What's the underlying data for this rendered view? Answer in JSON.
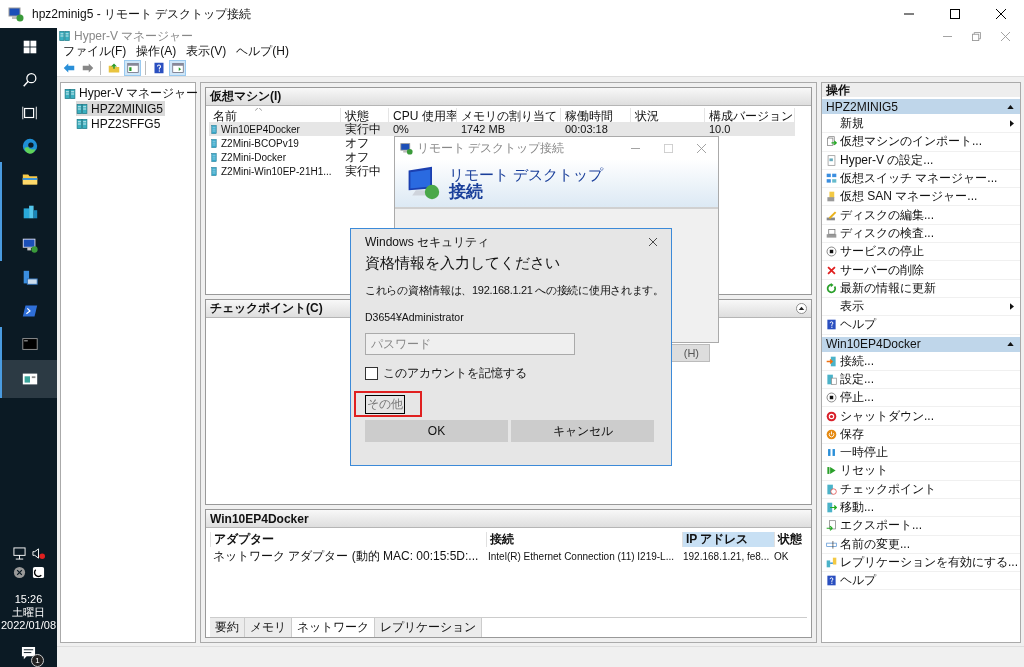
{
  "window": {
    "title": "hpz2minig5 - リモート デスクトップ接続"
  },
  "taskbar": {
    "apps": [
      {
        "running": false,
        "selected": false
      },
      {
        "running": false,
        "selected": false
      },
      {
        "running": false,
        "selected": false
      },
      {
        "running": false,
        "selected": false
      },
      {
        "running": true,
        "selected": false
      },
      {
        "running": true,
        "selected": false
      },
      {
        "running": true,
        "selected": false
      },
      {
        "running": false,
        "selected": false
      },
      {
        "running": false,
        "selected": false
      },
      {
        "running": true,
        "selected": false
      },
      {
        "running": true,
        "selected": true
      }
    ],
    "tray": {
      "time": "15:26",
      "day": "土曜日",
      "date": "2022/01/08",
      "notification_count": "1"
    }
  },
  "hyperv": {
    "title": "Hyper-V マネージャー",
    "menu": [
      "ファイル(F)",
      "操作(A)",
      "表示(V)",
      "ヘルプ(H)"
    ],
    "toolbar": [
      {
        "pressed": false
      },
      {
        "pressed": false
      },
      {
        "pressed": false
      },
      {
        "pressed": true
      },
      {
        "pressed": false
      },
      {
        "pressed": true
      }
    ]
  },
  "tree": {
    "label": "Hyper-V マネージャー",
    "selected": false,
    "children": [
      {
        "label": "HPZ2MINIG5",
        "selected": true
      },
      {
        "label": "HPZ2SFFG5",
        "selected": false
      }
    ]
  },
  "vm_panel": {
    "title": "仮想マシン(I)",
    "columns": [
      "名前",
      "状態",
      "CPU 使用率",
      "メモリの割り当て",
      "稼働時間",
      "状況",
      "構成バージョン"
    ],
    "rows": [
      {
        "name": "Win10EP4Docker",
        "state": "実行中",
        "cpu": "0%",
        "memory": "1742 MB",
        "uptime": "00:03:18",
        "version": "10.0",
        "selected": true
      },
      {
        "name": "Z2Mini-BCOPv19",
        "state": "オフ",
        "selected": false
      },
      {
        "name": "Z2Mini-Docker",
        "state": "オフ",
        "selected": false
      },
      {
        "name": "Z2Mini-Win10EP-21H1...",
        "state": "実行中",
        "selected": false
      }
    ]
  },
  "checkpoint_panel": {
    "title": "チェックポイント(C)",
    "expanded": true
  },
  "detail_panel": {
    "title": "Win10EP4Docker",
    "columns": [
      {
        "label": "アダプター",
        "sorted": false
      },
      {
        "label": "接続",
        "sorted": false
      },
      {
        "label": "IP アドレス",
        "sorted": true
      },
      {
        "label": "状態",
        "sorted": false
      }
    ],
    "rows": [
      {
        "adapter": "ネットワーク アダプター (動的 MAC: 00:15:5D:...",
        "connection": "Intel(R) Ethernet Connection (11) I219-L...",
        "ip": "192.168.1.21,  fe8...",
        "status": "OK"
      }
    ],
    "tabs": [
      {
        "label": "要約",
        "selected": false
      },
      {
        "label": "メモリ",
        "selected": false
      },
      {
        "label": "ネットワーク",
        "selected": true
      },
      {
        "label": "レプリケーション",
        "selected": false
      }
    ]
  },
  "actions": {
    "title": "操作",
    "sections": [
      {
        "title": "HPZ2MINIG5",
        "expanded": true,
        "items": [
          {
            "label": "新規",
            "submenu": true
          },
          {
            "label": "仮想マシンのインポート...",
            "submenu": false
          },
          {
            "label": "Hyper-V の設定...",
            "submenu": false
          },
          {
            "label": "仮想スイッチ マネージャー...",
            "submenu": false
          },
          {
            "label": "仮想 SAN マネージャー...",
            "submenu": false
          },
          {
            "label": "ディスクの編集...",
            "submenu": false
          },
          {
            "label": "ディスクの検査...",
            "submenu": false
          },
          {
            "label": "サービスの停止",
            "submenu": false
          },
          {
            "label": "サーバーの削除",
            "submenu": false
          },
          {
            "label": "最新の情報に更新",
            "submenu": false
          },
          {
            "label": "表示",
            "submenu": true
          },
          {
            "label": "ヘルプ",
            "submenu": false
          }
        ]
      },
      {
        "title": "Win10EP4Docker",
        "expanded": true,
        "items": [
          {
            "label": "接続...",
            "submenu": false
          },
          {
            "label": "設定...",
            "submenu": false
          },
          {
            "label": "停止...",
            "submenu": false
          },
          {
            "label": "シャットダウン...",
            "submenu": false
          },
          {
            "label": "保存",
            "submenu": false
          },
          {
            "label": "一時停止",
            "submenu": false
          },
          {
            "label": "リセット",
            "submenu": false
          },
          {
            "label": "チェックポイント",
            "submenu": false
          },
          {
            "label": "移動...",
            "submenu": false
          },
          {
            "label": "エクスポート...",
            "submenu": false
          },
          {
            "label": "名前の変更...",
            "submenu": false
          },
          {
            "label": "レプリケーションを有効にする...",
            "submenu": false
          },
          {
            "label": "ヘルプ",
            "submenu": false
          }
        ]
      }
    ]
  },
  "rdp_dialog": {
    "title": "リモート デスクトップ接続",
    "banner_line1": "リモート デスクトップ",
    "banner_line2": "接続",
    "button": "(H)"
  },
  "security_dialog": {
    "title": "Windows セキュリティ",
    "heading": "資格情報を入力してください",
    "message": "これらの資格情報は、192.168.1.21 への接続に使用されます。",
    "username": "D3654¥Administrator",
    "password": {
      "placeholder": "パスワード"
    },
    "remember": {
      "label": "このアカウントを記憶する",
      "checked": false
    },
    "more": {
      "label": "その他",
      "highlighted": true
    },
    "buttons": [
      "OK",
      "キャンセル"
    ]
  }
}
